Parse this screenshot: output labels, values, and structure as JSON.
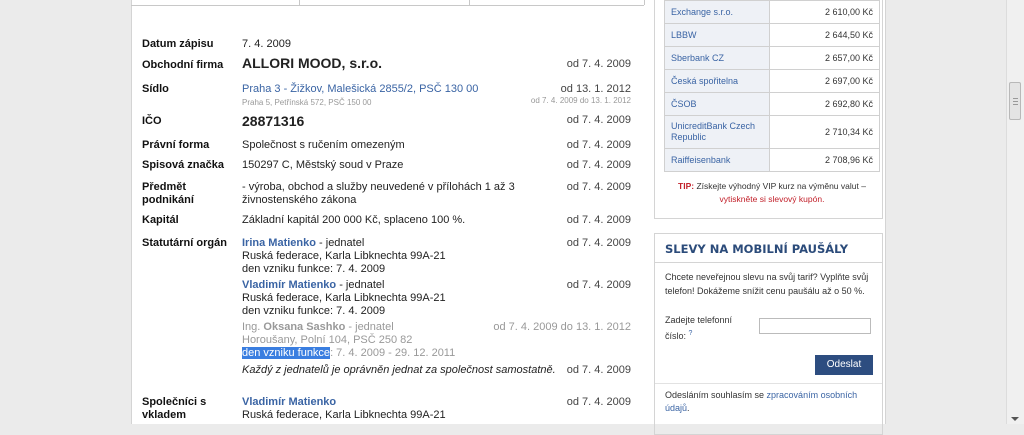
{
  "record": {
    "datum_zapisu": {
      "label": "Datum zápisu",
      "value": "7. 4. 2009"
    },
    "obchodni_firma": {
      "label": "Obchodní firma",
      "value": "ALLORI MOOD, s.r.o.",
      "date": "od 7. 4. 2009"
    },
    "sidlo": {
      "label": "Sídlo",
      "value": "Praha 3 - Žižkov, Malešická 2855/2, PSČ 130 00",
      "date": "od 13. 1. 2012",
      "old_value": "Praha 5, Petřínská 572, PSČ 150 00",
      "old_date": "od 7. 4. 2009 do 13. 1. 2012"
    },
    "ico": {
      "label": "IČO",
      "value": "28871316",
      "date": "od 7. 4. 2009"
    },
    "pravni_forma": {
      "label": "Právní forma",
      "value": "Společnost s ručením omezeným",
      "date": "od 7. 4. 2009"
    },
    "spisova_znacka": {
      "label": "Spisová značka",
      "value": "150297 C, Městský soud v Praze",
      "date": "od 7. 4. 2009"
    },
    "predmet": {
      "label_1": "Předmět",
      "label_2": "podnikání",
      "value_1": "- výroba, obchod a služby neuvedené v přílohách 1 až 3",
      "value_2": "živnostenského zákona",
      "date": "od 7. 4. 2009"
    },
    "kapital": {
      "label": "Kapitál",
      "value": "Základní kapitál 200 000 Kč, splaceno 100 %.",
      "date": "od 7. 4. 2009"
    },
    "statutarni": {
      "label": "Statutární orgán",
      "persons": [
        {
          "name": "Irina Matienko",
          "role": " - jednatel",
          "addr": "Ruská federace, Karla Libknechta 99A-21",
          "func": "den vzniku funkce: 7. 4. 2009",
          "date": "od 7. 4. 2009"
        },
        {
          "name": "Vladimír Matienko",
          "role": " - jednatel",
          "addr": "Ruská federace, Karla Libknechta 99A-21",
          "func": "den vzniku funkce: 7. 4. 2009",
          "date": "od 7. 4. 2009"
        }
      ],
      "former": {
        "prefix": "Ing. ",
        "name": "Oksana Sashko",
        "role": " - jednatel",
        "addr": "Horoušany, Polní 104, PSČ 250 82",
        "func_highlight": "den vzniku funkce",
        "func_rest": ": 7. 4. 2009 - 29. 12. 2011",
        "date": "od 7. 4. 2009 do 13. 1. 2012"
      },
      "note": "Každý z jednatelů je oprávněn jednat za společnost samostatně.",
      "note_date": "od 7. 4. 2009"
    },
    "spolecnici": {
      "label_1": "Společníci s",
      "label_2": "vkladem",
      "name": "Vladimír Matienko",
      "addr": "Ruská federace, Karla Libknechta 99A-21",
      "date": "od 7. 4. 2009"
    }
  },
  "rates": [
    {
      "bank": "Exchange s.r.o.",
      "price": "2 610,00 Kč"
    },
    {
      "bank": "LBBW",
      "price": "2 644,50 Kč"
    },
    {
      "bank": "Sberbank CZ",
      "price": "2 657,00 Kč"
    },
    {
      "bank": "Česká spořitelna",
      "price": "2 697,00 Kč"
    },
    {
      "bank": "ČSOB",
      "price": "2 692,80 Kč"
    },
    {
      "bank": "UnicreditBank Czech Republic",
      "price": "2 710,34 Kč"
    },
    {
      "bank": "Raiffeisenbank",
      "price": "2 708,96 Kč"
    }
  ],
  "tip": {
    "prefix": "TIP:",
    "text": " Získejte výhodný VIP kurz na výměnu valut –",
    "link": "vytiskněte si slevový kupón."
  },
  "mobile_box": {
    "title": "SLEVY NA MOBILNÍ PAUŠÁLY",
    "text": "Chcete neveřejnou slevu na svůj tarif? Vyplňte svůj telefon! Dokážeme snížit cenu paušálu až o 50 %.",
    "field_label": "Zadejte telefonní číslo:",
    "help": "?",
    "submit": "Odeslat",
    "foot_prefix": "Odesláním souhlasím se ",
    "foot_link": "zpracováním osobních údajů",
    "foot_suffix": "."
  }
}
